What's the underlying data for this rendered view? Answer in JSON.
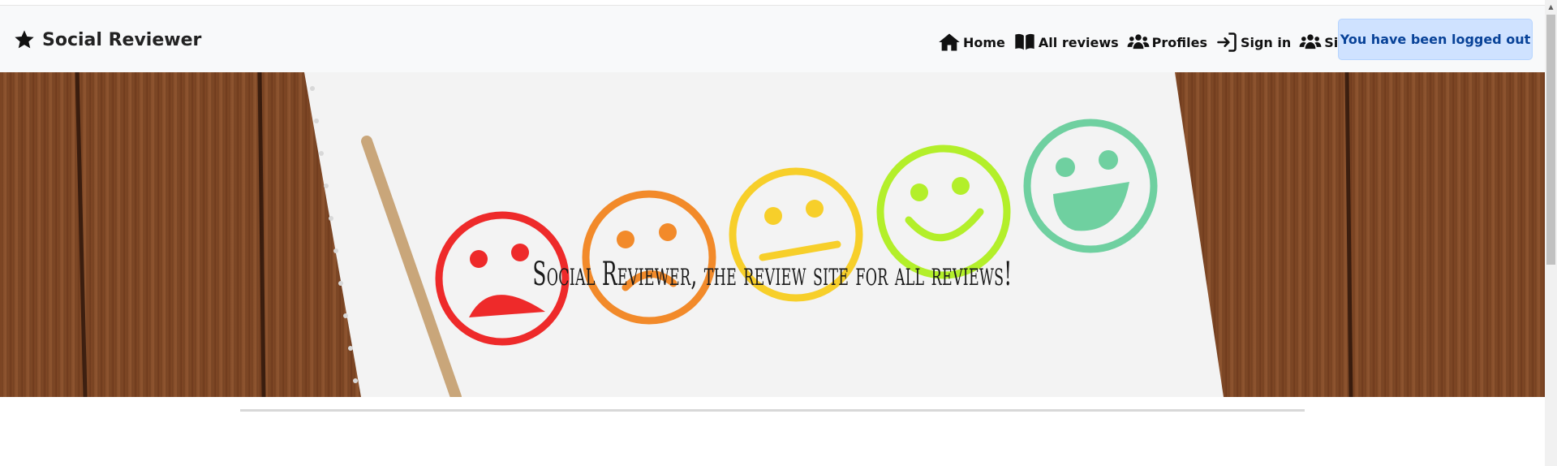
{
  "brand": {
    "icon": "star-icon",
    "title": "Social Reviewer"
  },
  "nav": {
    "items": [
      {
        "icon": "home-icon",
        "label": "Home"
      },
      {
        "icon": "book-icon",
        "label": "All reviews"
      },
      {
        "icon": "users-icon",
        "label": "Profiles"
      },
      {
        "icon": "sign-in-icon",
        "label": "Sign in"
      },
      {
        "icon": "users-icon",
        "label": "Sign Up"
      }
    ]
  },
  "alert": {
    "text": "You have been logged out",
    "background": "#cfe2ff",
    "text_color": "#084298"
  },
  "hero": {
    "title": "Social Reviewer, the review site for all reviews!"
  },
  "colors": {
    "navbar_bg": "#f8f9fa",
    "face_red": "#ee2a2a",
    "face_orange": "#f28a2a",
    "face_yellow": "#f7cf2a",
    "face_lime": "#b3ef2a",
    "face_green": "#6fd0a0"
  }
}
